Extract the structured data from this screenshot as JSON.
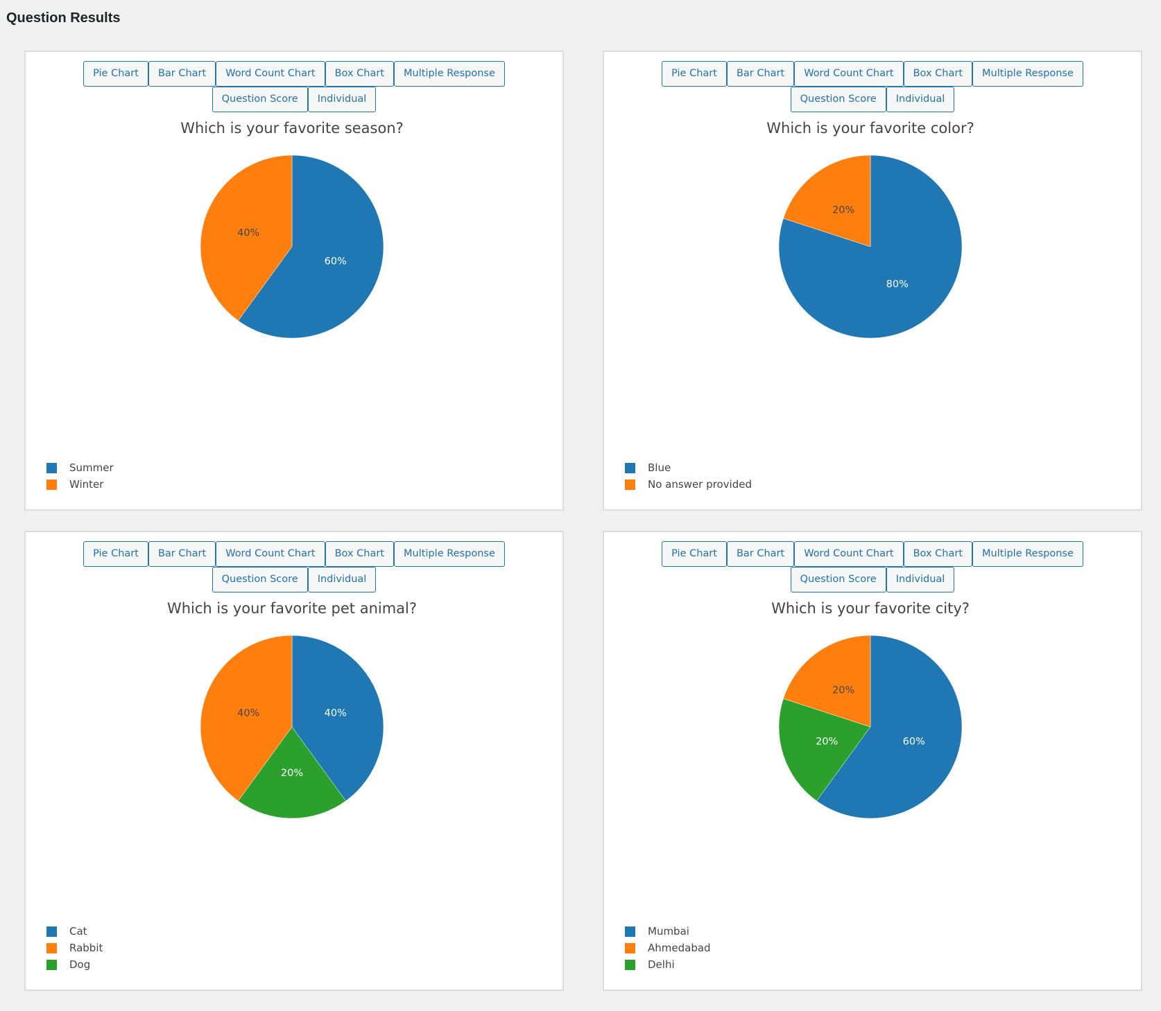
{
  "page": {
    "title": "Question Results"
  },
  "buttons": [
    "Pie Chart",
    "Bar Chart",
    "Word Count Chart",
    "Box Chart",
    "Multiple Response",
    "Question Score",
    "Individual"
  ],
  "colors": {
    "blue": "#1f77b4",
    "orange": "#ff7f0e",
    "green": "#2ca02c",
    "label_dark": "#444444",
    "label_light": "#ffffff",
    "button_accent": "#2271b1"
  },
  "chart_data": [
    {
      "type": "pie",
      "title": "Which is your favorite season?",
      "labels": [
        "Summer",
        "Winter"
      ],
      "values": [
        60,
        40
      ],
      "text": [
        "60%",
        "40%"
      ],
      "colors": [
        "#1f77b4",
        "#ff7f0e"
      ],
      "legend": "bottom-left"
    },
    {
      "type": "pie",
      "title": "Which is your favorite color?",
      "labels": [
        "Blue",
        "No answer provided"
      ],
      "values": [
        80,
        20
      ],
      "text": [
        "80%",
        "20%"
      ],
      "colors": [
        "#1f77b4",
        "#ff7f0e"
      ],
      "legend": "bottom-left"
    },
    {
      "type": "pie",
      "title": "Which is your favorite pet animal?",
      "labels": [
        "Cat",
        "Rabbit",
        "Dog"
      ],
      "values": [
        40,
        40,
        20
      ],
      "text": [
        "40%",
        "40%",
        "20%"
      ],
      "colors": [
        "#1f77b4",
        "#ff7f0e",
        "#2ca02c"
      ],
      "legend": "bottom-left"
    },
    {
      "type": "pie",
      "title": "Which is your favorite city?",
      "labels": [
        "Mumbai",
        "Ahmedabad",
        "Delhi"
      ],
      "values": [
        60,
        20,
        20
      ],
      "text": [
        "60%",
        "20%",
        "20%"
      ],
      "colors": [
        "#1f77b4",
        "#ff7f0e",
        "#2ca02c"
      ],
      "legend": "bottom-left"
    }
  ]
}
